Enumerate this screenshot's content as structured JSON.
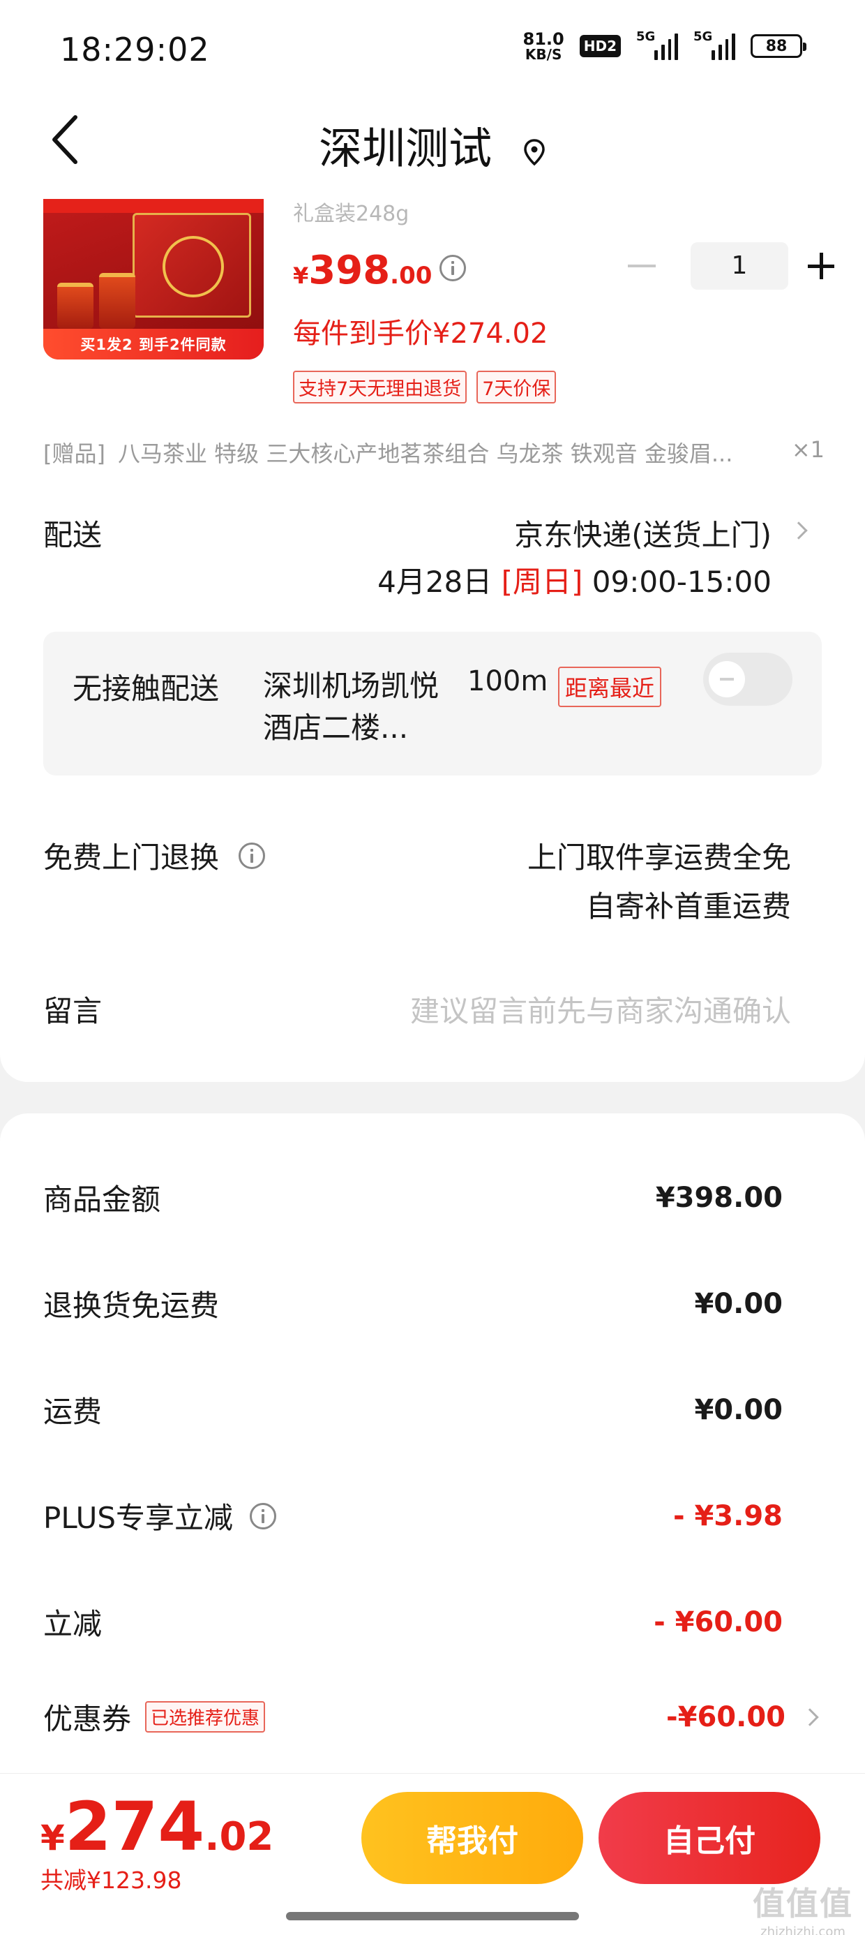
{
  "status_bar": {
    "time": "18:29:02",
    "net_speed_value": "81.0",
    "net_speed_unit": "KB/S",
    "hd_badge": "HD2",
    "signal_1_label": "5G",
    "signal_2_label": "5G",
    "battery_level": "88"
  },
  "nav": {
    "title": "深圳测试",
    "back_icon": "chevron-left-icon",
    "location_icon": "location-pin-icon"
  },
  "product": {
    "image_banner": "买1发2 到手2件同款",
    "spec": "礼盒装248g",
    "price_currency": "¥",
    "price_integer": "398",
    "price_decimal": ".00",
    "unit_price": "每件到手价¥274.02",
    "quantity": "1",
    "badges": [
      "支持7天无理由退货",
      "7天价保"
    ]
  },
  "gift": {
    "tag": "[赠品]",
    "description": "八马茶业 特级 三大核心产地茗茶组合 乌龙茶 铁观音 金骏眉...",
    "count": "×1"
  },
  "delivery": {
    "label": "配送",
    "method": "京东快递(送货上门)",
    "date": "4月28日",
    "weekday": "[周日]",
    "time": "09:00-15:00"
  },
  "contactless": {
    "label": "无接触配送",
    "location": "深圳机场凯悦酒店二楼...",
    "distance": "100m",
    "nearest_tag": "距离最近"
  },
  "free_return": {
    "label": "免费上门退换",
    "line1": "上门取件享运费全免",
    "line2": "自寄补首重运费"
  },
  "message": {
    "label": "留言",
    "placeholder": "建议留言前先与商家沟通确认"
  },
  "fees": [
    {
      "label": "商品金额",
      "value": "¥398.00"
    },
    {
      "label": "退换货免运费",
      "value": "¥0.00"
    },
    {
      "label": "运费",
      "value": "¥0.00"
    },
    {
      "label": "PLUS专享立减",
      "value": "- ¥3.98"
    },
    {
      "label": "立减",
      "value": "- ¥60.00"
    },
    {
      "label": "优惠券",
      "tag": "已选推荐优惠",
      "value": "-¥60.00"
    }
  ],
  "bottom_bar": {
    "total_currency": "¥",
    "total_integer": "274",
    "total_decimal": ".02",
    "saved": "共减¥123.98",
    "help_pay": "帮我付",
    "self_pay": "自己付"
  },
  "watermark": {
    "logo": "值值值",
    "url": "zhizhizhi.com"
  },
  "colors": {
    "accent_red": "#e51f17",
    "help_button": "#ffb714",
    "self_button": "#ec2f35"
  }
}
